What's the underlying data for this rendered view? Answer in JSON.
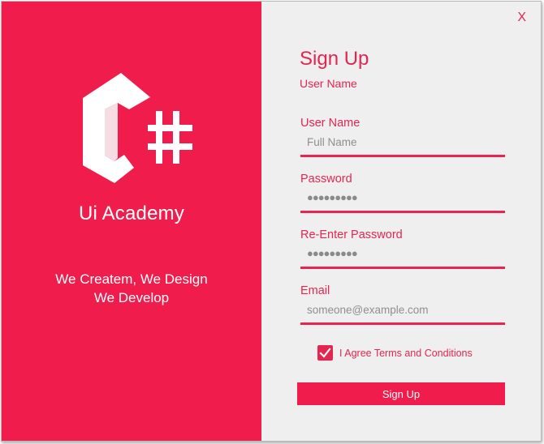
{
  "branding": {
    "logo_text": "C#",
    "name": "Ui Academy",
    "tagline_line1": "We Createm, We Design",
    "tagline_line2": "We Develop"
  },
  "window": {
    "close_label": "X"
  },
  "form": {
    "title": "Sign Up",
    "subtitle": "User Name",
    "fields": {
      "username": {
        "label": "User Name",
        "placeholder": "Full Name",
        "value": ""
      },
      "password": {
        "label": "Password",
        "value": "●●●●●●●●●"
      },
      "reenter_password": {
        "label": "Re-Enter Password",
        "value": "●●●●●●●●●"
      },
      "email": {
        "label": "Email",
        "placeholder": "someone@example.com",
        "value": ""
      }
    },
    "terms": {
      "label": "I Agree Terms and Conditions",
      "checked": true
    },
    "submit_label": "Sign Up"
  },
  "colors": {
    "accent": "#f01c4c",
    "panel_background": "#efefef",
    "text_on_accent": "#ffffff"
  }
}
